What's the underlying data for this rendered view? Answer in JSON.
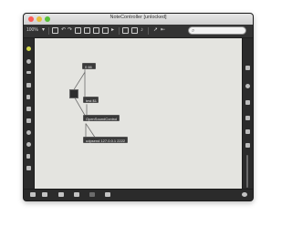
{
  "window": {
    "title": "NoteController [unlocked]"
  },
  "toolbar": {
    "zoom": "100%",
    "search_placeholder": ""
  },
  "patch": {
    "objects": [
      {
        "id": "obj-msg-0",
        "text": "0 66"
      },
      {
        "id": "obj-msg-1",
        "text": "test $1"
      },
      {
        "id": "obj-osc",
        "text": "OpenSoundControl"
      },
      {
        "id": "obj-udp",
        "text": "udpsend 127.0.0.1 2222"
      }
    ]
  },
  "icons": {
    "left_sidebar": [
      "toggle-icon",
      "comment-icon",
      "list-icon",
      "music-icon",
      "bracket-icon",
      "image-icon",
      "link-icon",
      "gear-icon",
      "info-icon",
      "mic-icon",
      "star-icon"
    ],
    "right_sidebar": [
      "grid-icon",
      "info-icon",
      "chat-icon",
      "inspector-icon",
      "clipboard-icon",
      "frame-icon",
      "volume-slider-icon",
      "settings-icon"
    ],
    "bottom_bar": [
      "lock-icon",
      "presentation-icon",
      "grid-icon",
      "mute-icon",
      "wrench-icon"
    ]
  },
  "colors": {
    "canvas": "#e4e4e0",
    "chrome": "#2f2f2f",
    "object_fill": "#3a3a3a",
    "close": "#fc5b57",
    "minimize": "#e5bf3c",
    "maximize": "#57c038"
  }
}
